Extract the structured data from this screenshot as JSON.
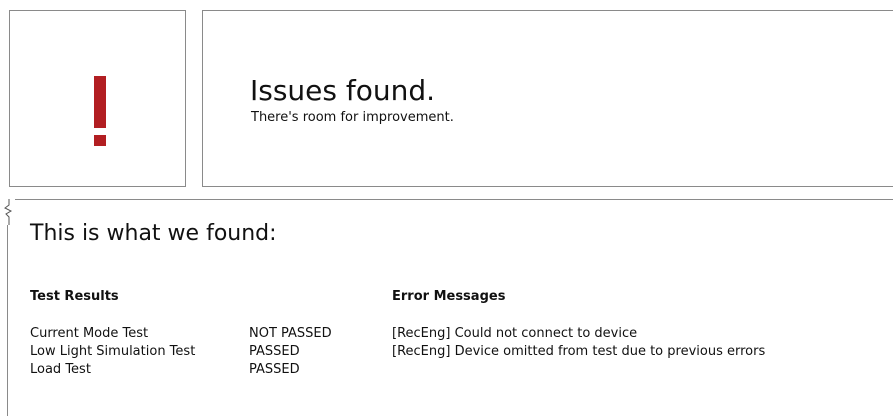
{
  "status": {
    "icon": "exclamation-icon",
    "icon_color": "#b21e22"
  },
  "headline": {
    "title": "Issues found.",
    "subtitle": "There's room for improvement."
  },
  "results": {
    "heading": "This is what we found:",
    "tests_heading": "Test Results",
    "errors_heading": "Error Messages",
    "tests": [
      {
        "name": "Current Mode Test",
        "status": "NOT PASSED"
      },
      {
        "name": "Low Light Simulation Test",
        "status": "PASSED"
      },
      {
        "name": "Load Test",
        "status": "PASSED"
      }
    ],
    "errors": [
      "[RecEng] Could not connect to device",
      "[RecEng] Device omitted from test due to previous errors"
    ]
  }
}
